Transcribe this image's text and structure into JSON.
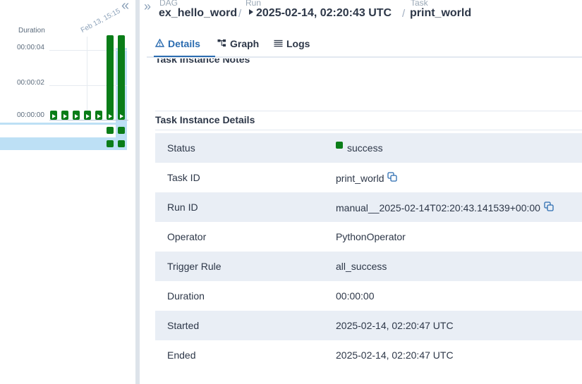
{
  "grid": {
    "collapse_icon": "«",
    "duration_label": "Duration",
    "ticks": [
      "00:00:04",
      "00:00:02",
      "00:00:00"
    ],
    "date_label": "Feb 13, 15:15",
    "bar_values_sec": [
      0.2,
      0.2,
      0.2,
      0.2,
      0.2,
      4.8,
      4.8
    ],
    "colors": {
      "success": "#0a7d18",
      "selected": "#bde0f5"
    }
  },
  "header": {
    "expand_icon": "»",
    "dag_label": "DAG",
    "dag_value": "ex_hello_word",
    "run_label": "Run",
    "run_value": "2025-02-14, 02:20:43 UTC",
    "task_label": "Task",
    "task_value": "print_world",
    "separator": "/"
  },
  "tabs": [
    {
      "label": "Details",
      "icon": "warning-triangle-icon",
      "active": true
    },
    {
      "label": "Graph",
      "icon": "graph-icon",
      "active": false
    },
    {
      "label": "Logs",
      "icon": "list-icon",
      "active": false
    }
  ],
  "notes_heading": "Task Instance Notes",
  "details": {
    "title": "Task Instance Details",
    "rows": [
      {
        "label": "Status",
        "value": "success"
      },
      {
        "label": "Task ID",
        "value": "print_world"
      },
      {
        "label": "Run ID",
        "value": "manual__2025-02-14T02:20:43.141539+00:00"
      },
      {
        "label": "Operator",
        "value": "PythonOperator"
      },
      {
        "label": "Trigger Rule",
        "value": "all_success"
      },
      {
        "label": "Duration",
        "value": "00:00:00"
      },
      {
        "label": "Started",
        "value": "2025-02-14, 02:20:47 UTC"
      },
      {
        "label": "Ended",
        "value": "2025-02-14, 02:20:47 UTC"
      }
    ]
  }
}
